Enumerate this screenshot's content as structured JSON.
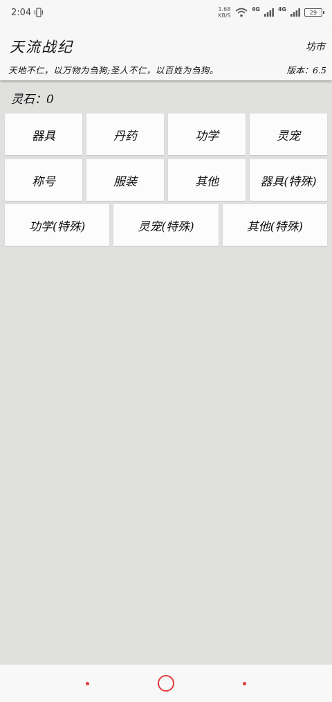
{
  "status_bar": {
    "time": "2:04",
    "speed_value": "1.68",
    "speed_unit": "KB/S",
    "net1": "4G",
    "net2": "4G",
    "battery": "29"
  },
  "header": {
    "title": "天流战纪",
    "market_link": "坊市",
    "motto": "天地不仁，以万物为刍狗;圣人不仁，以百姓为刍狗。",
    "version": "版本：6.5"
  },
  "spirit_stone": "灵石：0",
  "categories_row1": [
    "器具",
    "丹药",
    "功学",
    "灵宠"
  ],
  "categories_row2": [
    "称号",
    "服装",
    "其他",
    "器具(特殊)"
  ],
  "categories_row3": [
    "功学(特殊)",
    "灵宠(特殊)",
    "其他(特殊)"
  ],
  "colors": {
    "accent": "#e23b3b",
    "background": "#e0e0df",
    "card": "#fcfcfc"
  }
}
